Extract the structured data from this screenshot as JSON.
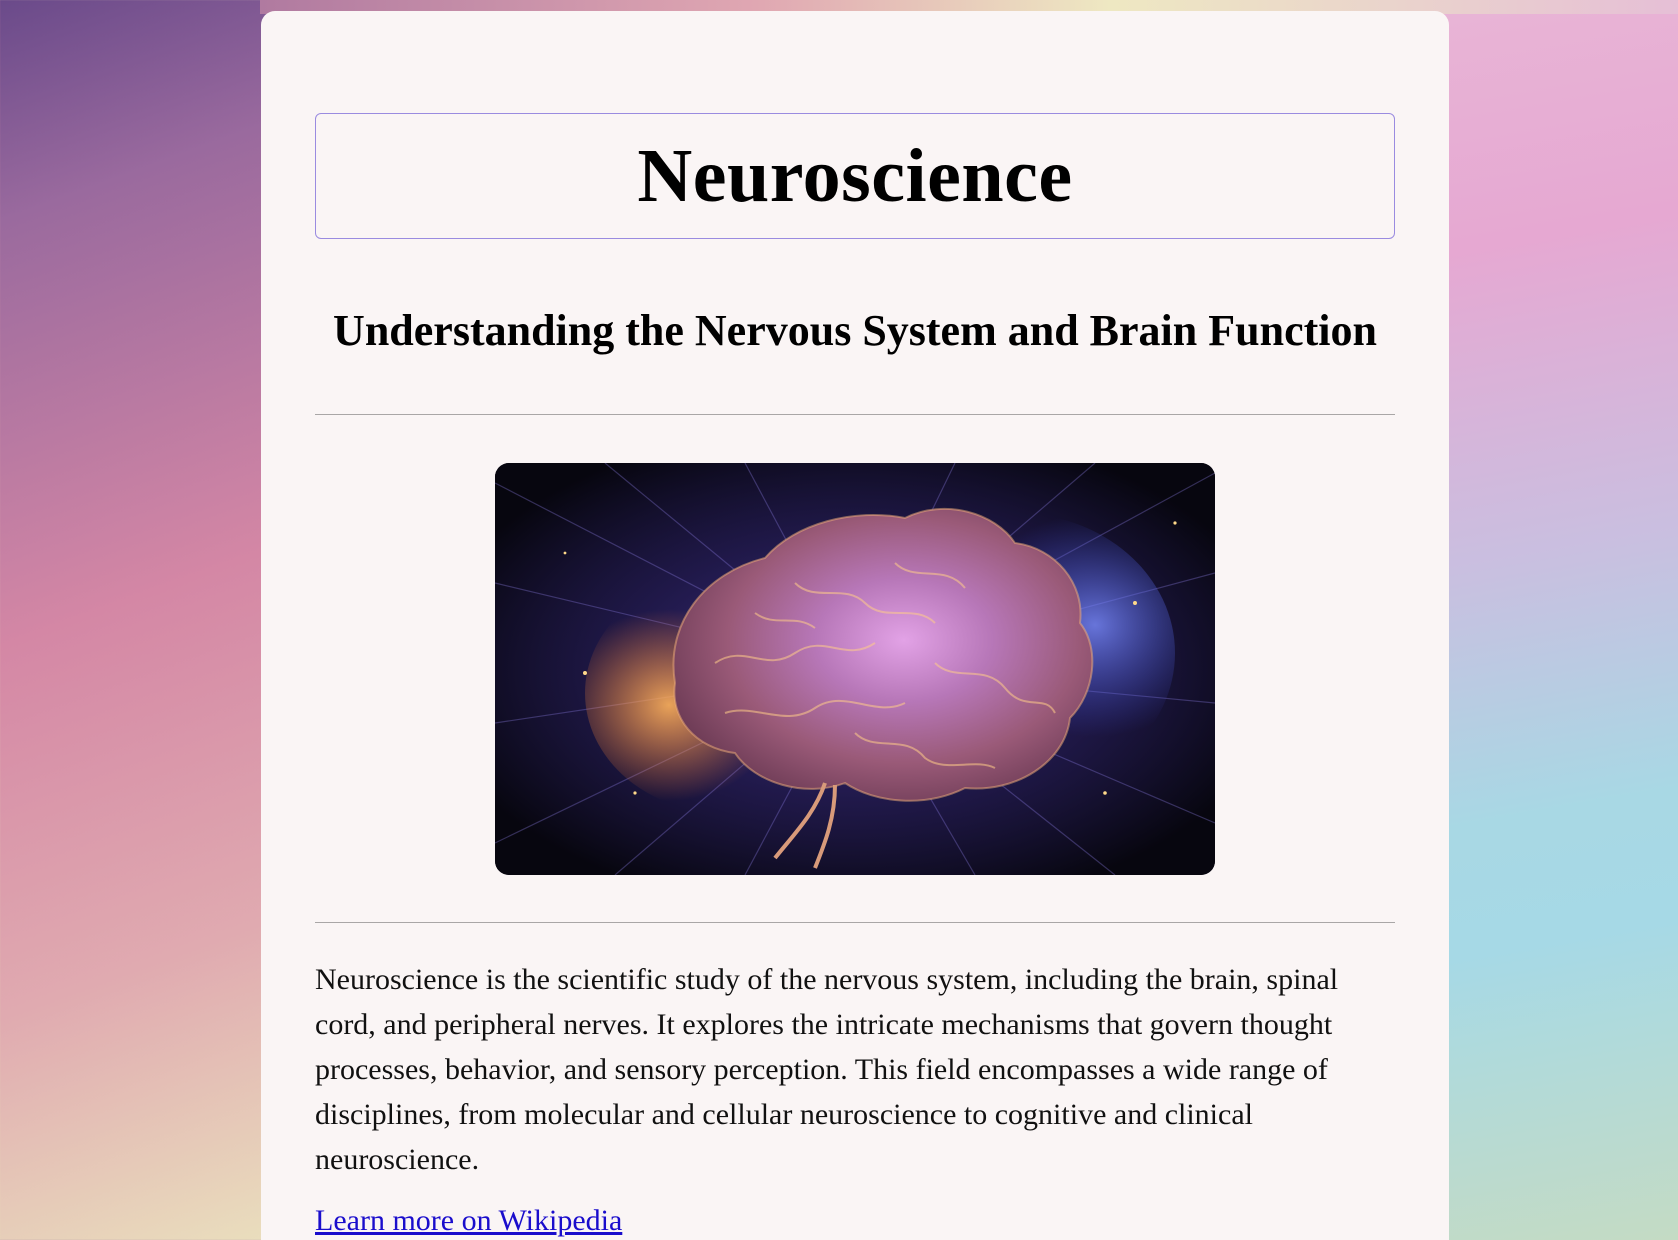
{
  "page": {
    "title": "Neuroscience",
    "subtitle": "Understanding the Nervous System and Brain Function",
    "image": {
      "icon": "brain-illustration",
      "colors": {
        "background": "#0b0a1c",
        "glow_warm": "#f08a3c",
        "glow_cool": "#5a6cf0",
        "brain_pink": "#d08ad6"
      }
    },
    "description": "Neuroscience is the scientific study of the nervous system, including the brain, spinal cord, and peripheral nerves. It explores the intricate mechanisms that govern thought processes, behavior, and sensory perception. This field encompasses a wide range of disciplines, from molecular and cellular neuroscience to cognitive and clinical neuroscience.",
    "link_text": "Learn more on Wikipedia"
  },
  "colors": {
    "card_background": "#faf5f5",
    "title_border": "#9a8be0",
    "link": "#1a0dcc",
    "divider": "#a9a6a6"
  }
}
